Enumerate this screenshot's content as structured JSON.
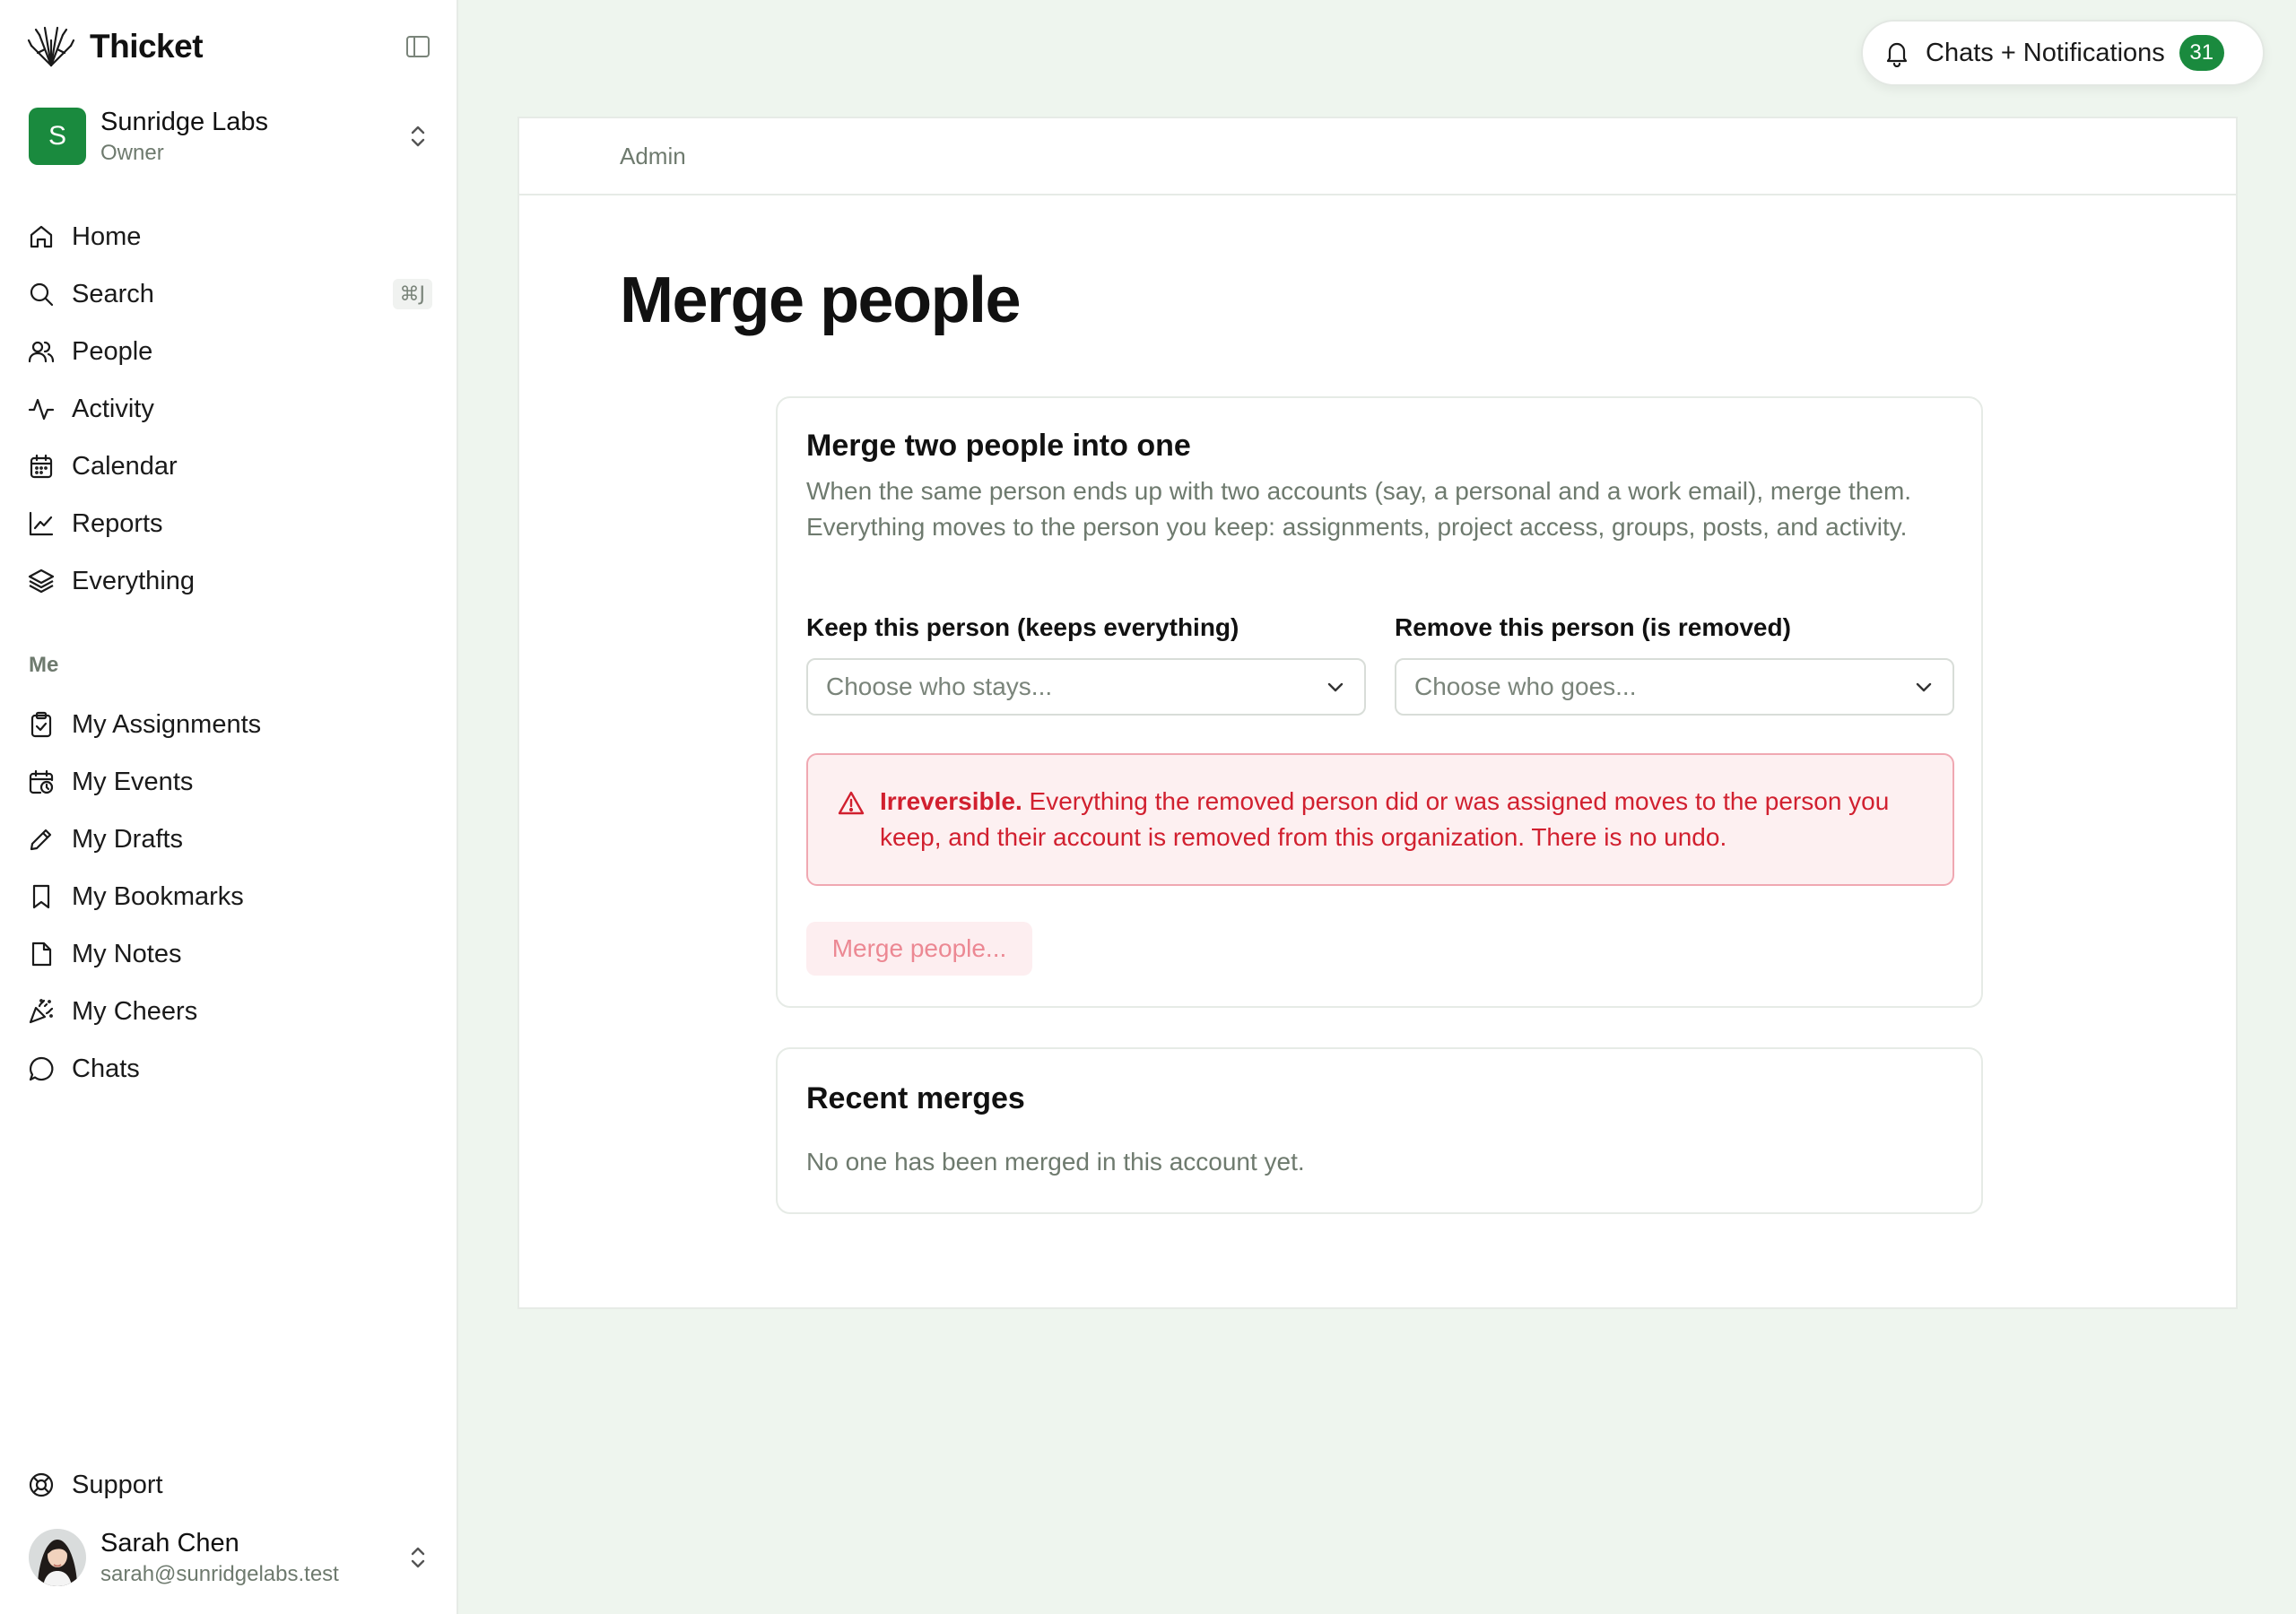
{
  "app": {
    "name": "Thicket"
  },
  "org": {
    "initial": "S",
    "name": "Sunridge Labs",
    "role": "Owner"
  },
  "nav": {
    "items": [
      {
        "label": "Home"
      },
      {
        "label": "Search",
        "shortcut": "⌘J"
      },
      {
        "label": "People"
      },
      {
        "label": "Activity"
      },
      {
        "label": "Calendar"
      },
      {
        "label": "Reports"
      },
      {
        "label": "Everything"
      }
    ],
    "me_heading": "Me",
    "me_items": [
      {
        "label": "My Assignments"
      },
      {
        "label": "My Events"
      },
      {
        "label": "My Drafts"
      },
      {
        "label": "My Bookmarks"
      },
      {
        "label": "My Notes"
      },
      {
        "label": "My Cheers"
      },
      {
        "label": "Chats"
      }
    ],
    "support": "Support"
  },
  "user": {
    "name": "Sarah Chen",
    "email": "sarah@sunridgelabs.test"
  },
  "notifications": {
    "label": "Chats + Notifications",
    "count": "31"
  },
  "breadcrumb": "Admin",
  "page_title": "Merge people",
  "merge_card": {
    "title": "Merge two people into one",
    "description": "When the same person ends up with two accounts (say, a personal and a work email), merge them. Everything moves to the person you keep: assignments, project access, groups, posts, and activity.",
    "keep_label": "Keep this person (keeps everything)",
    "keep_placeholder": "Choose who stays...",
    "remove_label": "Remove this person (is removed)",
    "remove_placeholder": "Choose who goes...",
    "warning_strong": "Irreversible.",
    "warning_text": " Everything the removed person did or was assigned moves to the person you keep, and their account is removed from this organization. There is no undo.",
    "button_label": "Merge people..."
  },
  "recent_card": {
    "title": "Recent merges",
    "empty_text": "No one has been merged in this account yet."
  },
  "colors": {
    "accent": "#1a8a3e",
    "danger": "#d1202f",
    "danger_bg": "#fdf0f1",
    "page_bg": "#eef5ee"
  }
}
